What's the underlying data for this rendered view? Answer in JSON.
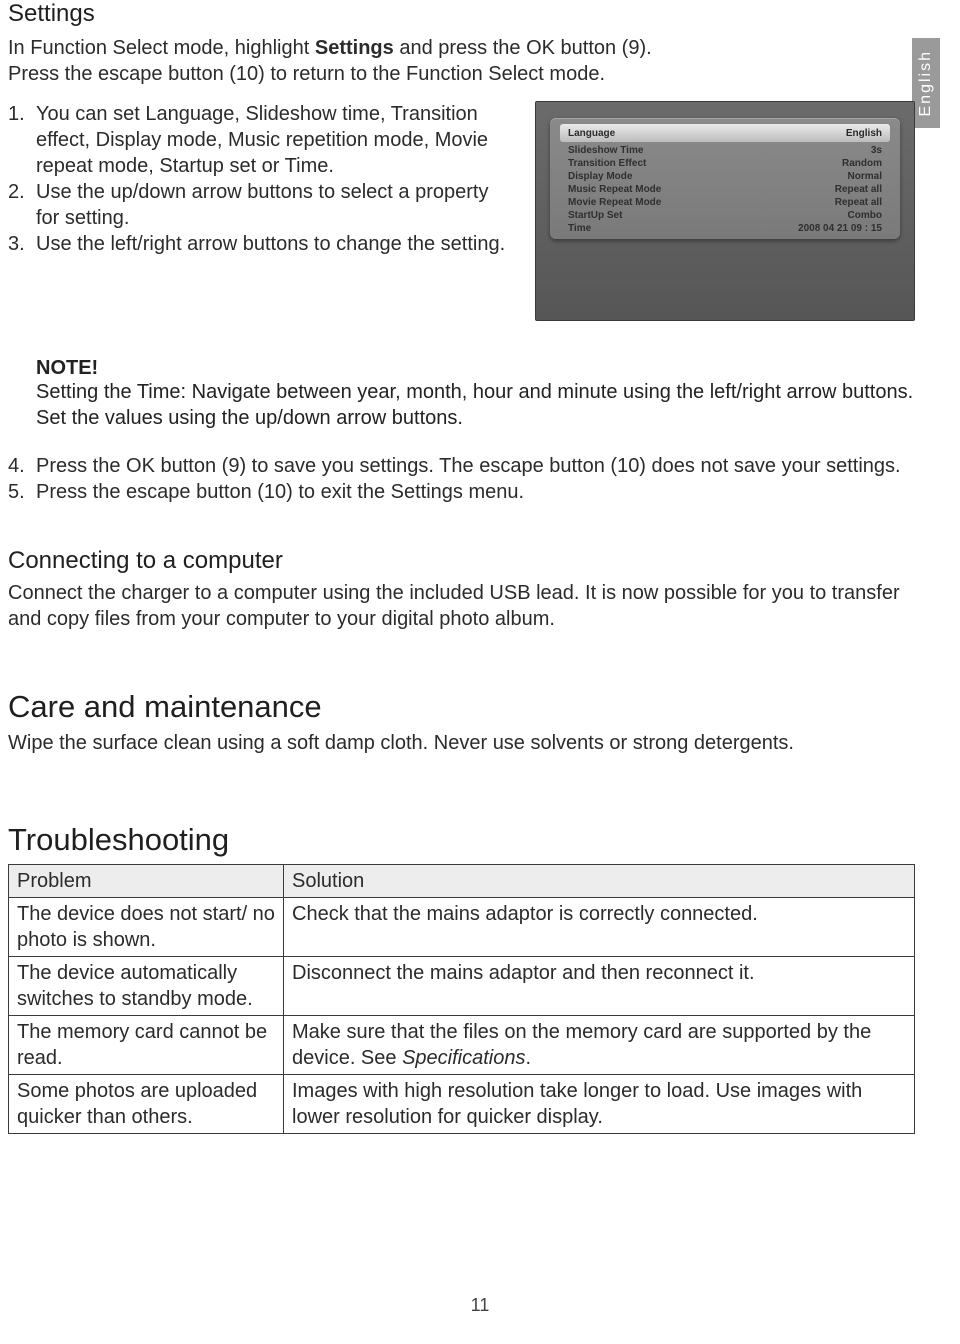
{
  "language_tab": "English",
  "settings": {
    "heading": "Settings",
    "intro_a": "In Function Select mode, highlight ",
    "intro_bold": "Settings",
    "intro_b": " and press the OK button (9).",
    "intro_line2": "Press the escape button (10) to return to the Function Select mode.",
    "list1": {
      "n1": "1.",
      "i1": "You can set Language, Slideshow time, Transition effect, Display mode, Music repetition mode, Movie repeat mode, Startup set or Time.",
      "n2": "2.",
      "i2": "Use the up/down arrow buttons to select a property for setting.",
      "n3": "3.",
      "i3": "Use the left/right arrow buttons to change the setting."
    },
    "note": {
      "title": "NOTE!",
      "text": "Setting the Time: Navigate between year, month, hour and minute using the left/right arrow buttons. Set the values using the up/down arrow buttons."
    },
    "list2": {
      "n4": "4.",
      "i4": "Press the OK button (9) to save you settings. The escape button (10) does not save your settings.",
      "n5": "5.",
      "i5": "Press the escape button (10) to exit the Settings menu."
    }
  },
  "screenshot": {
    "rows": [
      {
        "label": "Language",
        "value": "English",
        "selected": true
      },
      {
        "label": "Slideshow Time",
        "value": "3s"
      },
      {
        "label": "Transition Effect",
        "value": "Random"
      },
      {
        "label": "Display Mode",
        "value": "Normal"
      },
      {
        "label": "Music Repeat Mode",
        "value": "Repeat all"
      },
      {
        "label": "Movie Repeat Mode",
        "value": "Repeat all"
      },
      {
        "label": "StartUp Set",
        "value": "Combo"
      },
      {
        "label": "Time",
        "value": "2008   04   21      09  :  15"
      }
    ]
  },
  "connecting": {
    "heading": "Connecting to a computer",
    "text": "Connect the charger to a computer using the included USB lead. It is now possible for you to transfer and copy files from your computer to your digital photo album."
  },
  "care": {
    "heading": "Care and maintenance",
    "text": "Wipe the surface clean using a soft damp cloth. Never use solvents or strong detergents."
  },
  "troubleshooting": {
    "heading": "Troubleshooting",
    "th_problem": "Problem",
    "th_solution": "Solution",
    "rows": [
      {
        "p": "The device does not start/ no photo is shown.",
        "s": "Check that the mains adaptor is correctly connected."
      },
      {
        "p": "The device automatically switches to standby mode.",
        "s": "Disconnect the mains adaptor and then reconnect it."
      },
      {
        "p": "The memory card cannot be read.",
        "s_a": "Make sure that the files on the memory card are supported by the device. See ",
        "s_ital": "Specifications",
        "s_b": "."
      },
      {
        "p": "Some photos are uploaded quicker than others.",
        "s": "Images with high resolution take longer to load. Use images with lower resolution for quicker display."
      }
    ]
  },
  "page_number": "11"
}
